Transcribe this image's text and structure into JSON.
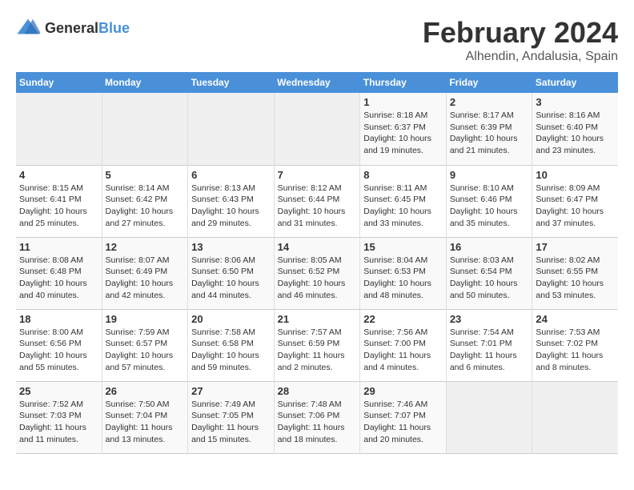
{
  "logo": {
    "text_general": "General",
    "text_blue": "Blue"
  },
  "title": "February 2024",
  "subtitle": "Alhendin, Andalusia, Spain",
  "days_header": [
    "Sunday",
    "Monday",
    "Tuesday",
    "Wednesday",
    "Thursday",
    "Friday",
    "Saturday"
  ],
  "weeks": [
    {
      "days": [
        {
          "num": "",
          "info": ""
        },
        {
          "num": "",
          "info": ""
        },
        {
          "num": "",
          "info": ""
        },
        {
          "num": "",
          "info": ""
        },
        {
          "num": "1",
          "info": "Sunrise: 8:18 AM\nSunset: 6:37 PM\nDaylight: 10 hours\nand 19 minutes."
        },
        {
          "num": "2",
          "info": "Sunrise: 8:17 AM\nSunset: 6:39 PM\nDaylight: 10 hours\nand 21 minutes."
        },
        {
          "num": "3",
          "info": "Sunrise: 8:16 AM\nSunset: 6:40 PM\nDaylight: 10 hours\nand 23 minutes."
        }
      ]
    },
    {
      "days": [
        {
          "num": "4",
          "info": "Sunrise: 8:15 AM\nSunset: 6:41 PM\nDaylight: 10 hours\nand 25 minutes."
        },
        {
          "num": "5",
          "info": "Sunrise: 8:14 AM\nSunset: 6:42 PM\nDaylight: 10 hours\nand 27 minutes."
        },
        {
          "num": "6",
          "info": "Sunrise: 8:13 AM\nSunset: 6:43 PM\nDaylight: 10 hours\nand 29 minutes."
        },
        {
          "num": "7",
          "info": "Sunrise: 8:12 AM\nSunset: 6:44 PM\nDaylight: 10 hours\nand 31 minutes."
        },
        {
          "num": "8",
          "info": "Sunrise: 8:11 AM\nSunset: 6:45 PM\nDaylight: 10 hours\nand 33 minutes."
        },
        {
          "num": "9",
          "info": "Sunrise: 8:10 AM\nSunset: 6:46 PM\nDaylight: 10 hours\nand 35 minutes."
        },
        {
          "num": "10",
          "info": "Sunrise: 8:09 AM\nSunset: 6:47 PM\nDaylight: 10 hours\nand 37 minutes."
        }
      ]
    },
    {
      "days": [
        {
          "num": "11",
          "info": "Sunrise: 8:08 AM\nSunset: 6:48 PM\nDaylight: 10 hours\nand 40 minutes."
        },
        {
          "num": "12",
          "info": "Sunrise: 8:07 AM\nSunset: 6:49 PM\nDaylight: 10 hours\nand 42 minutes."
        },
        {
          "num": "13",
          "info": "Sunrise: 8:06 AM\nSunset: 6:50 PM\nDaylight: 10 hours\nand 44 minutes."
        },
        {
          "num": "14",
          "info": "Sunrise: 8:05 AM\nSunset: 6:52 PM\nDaylight: 10 hours\nand 46 minutes."
        },
        {
          "num": "15",
          "info": "Sunrise: 8:04 AM\nSunset: 6:53 PM\nDaylight: 10 hours\nand 48 minutes."
        },
        {
          "num": "16",
          "info": "Sunrise: 8:03 AM\nSunset: 6:54 PM\nDaylight: 10 hours\nand 50 minutes."
        },
        {
          "num": "17",
          "info": "Sunrise: 8:02 AM\nSunset: 6:55 PM\nDaylight: 10 hours\nand 53 minutes."
        }
      ]
    },
    {
      "days": [
        {
          "num": "18",
          "info": "Sunrise: 8:00 AM\nSunset: 6:56 PM\nDaylight: 10 hours\nand 55 minutes."
        },
        {
          "num": "19",
          "info": "Sunrise: 7:59 AM\nSunset: 6:57 PM\nDaylight: 10 hours\nand 57 minutes."
        },
        {
          "num": "20",
          "info": "Sunrise: 7:58 AM\nSunset: 6:58 PM\nDaylight: 10 hours\nand 59 minutes."
        },
        {
          "num": "21",
          "info": "Sunrise: 7:57 AM\nSunset: 6:59 PM\nDaylight: 11 hours\nand 2 minutes."
        },
        {
          "num": "22",
          "info": "Sunrise: 7:56 AM\nSunset: 7:00 PM\nDaylight: 11 hours\nand 4 minutes."
        },
        {
          "num": "23",
          "info": "Sunrise: 7:54 AM\nSunset: 7:01 PM\nDaylight: 11 hours\nand 6 minutes."
        },
        {
          "num": "24",
          "info": "Sunrise: 7:53 AM\nSunset: 7:02 PM\nDaylight: 11 hours\nand 8 minutes."
        }
      ]
    },
    {
      "days": [
        {
          "num": "25",
          "info": "Sunrise: 7:52 AM\nSunset: 7:03 PM\nDaylight: 11 hours\nand 11 minutes."
        },
        {
          "num": "26",
          "info": "Sunrise: 7:50 AM\nSunset: 7:04 PM\nDaylight: 11 hours\nand 13 minutes."
        },
        {
          "num": "27",
          "info": "Sunrise: 7:49 AM\nSunset: 7:05 PM\nDaylight: 11 hours\nand 15 minutes."
        },
        {
          "num": "28",
          "info": "Sunrise: 7:48 AM\nSunset: 7:06 PM\nDaylight: 11 hours\nand 18 minutes."
        },
        {
          "num": "29",
          "info": "Sunrise: 7:46 AM\nSunset: 7:07 PM\nDaylight: 11 hours\nand 20 minutes."
        },
        {
          "num": "",
          "info": ""
        },
        {
          "num": "",
          "info": ""
        }
      ]
    }
  ]
}
